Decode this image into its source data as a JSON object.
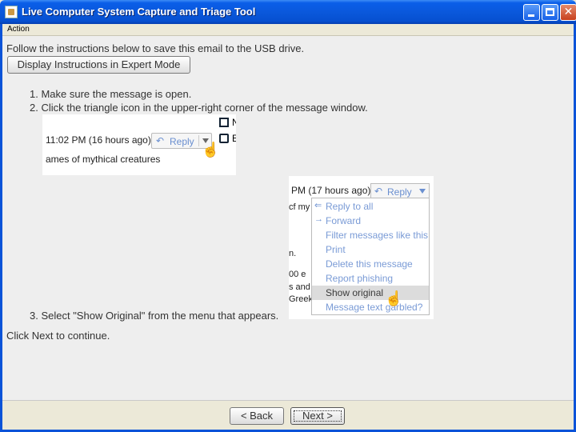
{
  "window": {
    "title": "Live Computer System Capture and Triage Tool"
  },
  "menubar": {
    "items": [
      "Action"
    ]
  },
  "content": {
    "instruction": "Follow the instructions below to save this email to the USB drive.",
    "expert_button": "Display Instructions in Expert Mode",
    "steps": [
      "1. Make sure the message is open.",
      "2. Click the triangle icon in the upper-right corner of the message window.",
      "3. Select \"Show Original\" from the menu that appears."
    ],
    "continue_text": "Click Next to continue."
  },
  "screenshot1": {
    "time": "11:02 PM (16 hours ago)",
    "reply": "Reply",
    "subject": "ames of mythical creatures",
    "side_n": "N",
    "side_e": "E"
  },
  "screenshot2": {
    "time": "PM (17 hours ago)",
    "reply": "Reply",
    "bg_lines": [
      "cf my",
      "n.",
      "00 e",
      "s and",
      "Greek"
    ],
    "menu_items": [
      {
        "label": "Reply to all",
        "icon": "reply-all-icon",
        "glyph": "⇐"
      },
      {
        "label": "Forward",
        "icon": "forward-icon",
        "glyph": "→"
      },
      {
        "label": "Filter messages like this",
        "icon": "",
        "glyph": ""
      },
      {
        "label": "Print",
        "icon": "",
        "glyph": ""
      },
      {
        "label": "Delete this message",
        "icon": "",
        "glyph": ""
      },
      {
        "label": "Report phishing",
        "icon": "",
        "glyph": ""
      },
      {
        "label": "Show original",
        "icon": "",
        "glyph": ""
      },
      {
        "label": "Message text garbled?",
        "icon": "",
        "glyph": ""
      }
    ],
    "selected_index": 6
  },
  "buttons": {
    "back": "< Back",
    "next": "Next >"
  },
  "colors": {
    "titlebar": "#0a58dc",
    "link_blue": "#7a9bd6",
    "selected_row": "#dcdcdc"
  }
}
